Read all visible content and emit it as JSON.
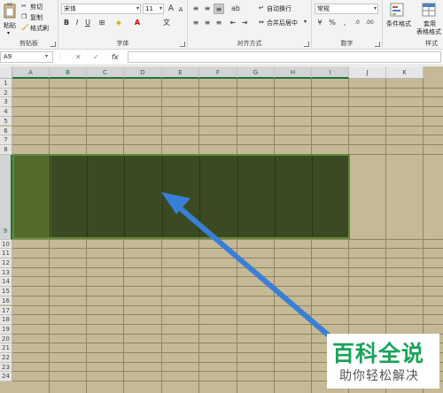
{
  "ribbon": {
    "clipboard": {
      "label": "剪贴板",
      "paste": "粘贴",
      "cut": "剪切",
      "copy": "复制",
      "format_painter": "格式刷"
    },
    "font": {
      "label": "字体",
      "name": "宋体",
      "size": "11",
      "bold": "B",
      "italic": "I",
      "underline": "U",
      "font_color_letter": "A"
    },
    "alignment": {
      "label": "对齐方式",
      "wrap_text": "自动换行",
      "merge_center": "合并后居中"
    },
    "number": {
      "label": "数字",
      "format": "常规",
      "percent": "%",
      "comma": ","
    },
    "styles": {
      "label": "样式",
      "conditional": "条件格式",
      "table_format_1": "套用",
      "table_format_2": "表格格式"
    }
  },
  "formula_bar": {
    "name_box": "A9",
    "fx": "fx"
  },
  "sheet": {
    "columns": [
      "A",
      "B",
      "C",
      "D",
      "E",
      "F",
      "G",
      "H",
      "I",
      "J",
      "K"
    ],
    "selected_columns": [
      "A",
      "B",
      "C",
      "D",
      "E",
      "F",
      "G",
      "H",
      "I"
    ],
    "rows": [
      "1",
      "2",
      "3",
      "4",
      "5",
      "6",
      "7",
      "8",
      "9",
      "10",
      "11",
      "12",
      "13",
      "14",
      "15",
      "16",
      "17",
      "18",
      "19",
      "20",
      "21",
      "22",
      "23",
      "24"
    ],
    "selected_row": "9",
    "active_cell": "A9",
    "colors": {
      "sheet_fill": "#c6b995",
      "selection_fill": "#3b4a22",
      "active_cell_fill": "#536a2d",
      "arrow": "#3a7fd6"
    }
  },
  "watermark": {
    "title": "百科全说",
    "subtitle": "助你轻松解决"
  }
}
